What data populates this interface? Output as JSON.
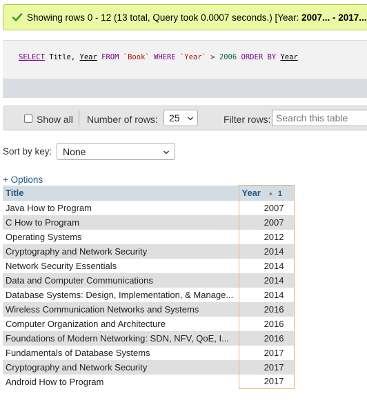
{
  "message": {
    "prefix": "Showing rows 0 - 12 (13 total, Query took 0.0007 seconds.) [Year: ",
    "range_bold": "2007... - 2017...",
    "suffix": "]"
  },
  "sql": {
    "select": "SELECT",
    "cols": "Title,",
    "col2": "Year",
    "from": "FROM",
    "table": "`Book`",
    "where": "WHERE",
    "wcol": "`Year`",
    "op": ">",
    "num": "2006",
    "orderby": "ORDER BY",
    "ocol": "Year"
  },
  "toolbar": {
    "show_all": "Show all",
    "num_rows_label": "Number of rows:",
    "num_rows_value": "25",
    "filter_label": "Filter rows:",
    "filter_placeholder": "Search this table"
  },
  "sort": {
    "label": "Sort by key:",
    "value": "None"
  },
  "options_link": "+ Options",
  "table": {
    "headers": {
      "title": "Title",
      "year": "Year",
      "sort_order": "1"
    },
    "rows": [
      {
        "title": "Java How to Program",
        "year": "2007"
      },
      {
        "title": "C How to Program",
        "year": "2007"
      },
      {
        "title": "Operating Systems",
        "year": "2012"
      },
      {
        "title": "Cryptography and Network Security",
        "year": "2014"
      },
      {
        "title": "Network Security Essentials",
        "year": "2014"
      },
      {
        "title": "Data and Computer Communications",
        "year": "2014"
      },
      {
        "title": "Database Systems: Design, Implementation, & Manage...",
        "year": "2014"
      },
      {
        "title": "Wireless Communication Networks and Systems",
        "year": "2016"
      },
      {
        "title": "Computer Organization and Architecture",
        "year": "2016"
      },
      {
        "title": "Foundations of Modern Networking: SDN, NFV, QoE, I...",
        "year": "2016"
      },
      {
        "title": "Fundamentals of Database Systems",
        "year": "2017"
      },
      {
        "title": "Cryptography and Network Security",
        "year": "2017"
      },
      {
        "title": "Android How to Program",
        "year": "2017"
      }
    ]
  },
  "colors": {
    "success_bg": "#ebf8a4",
    "header_bg": "#d3dce3",
    "link": "#235a81",
    "sorted_column_border": "#e6b37c"
  }
}
